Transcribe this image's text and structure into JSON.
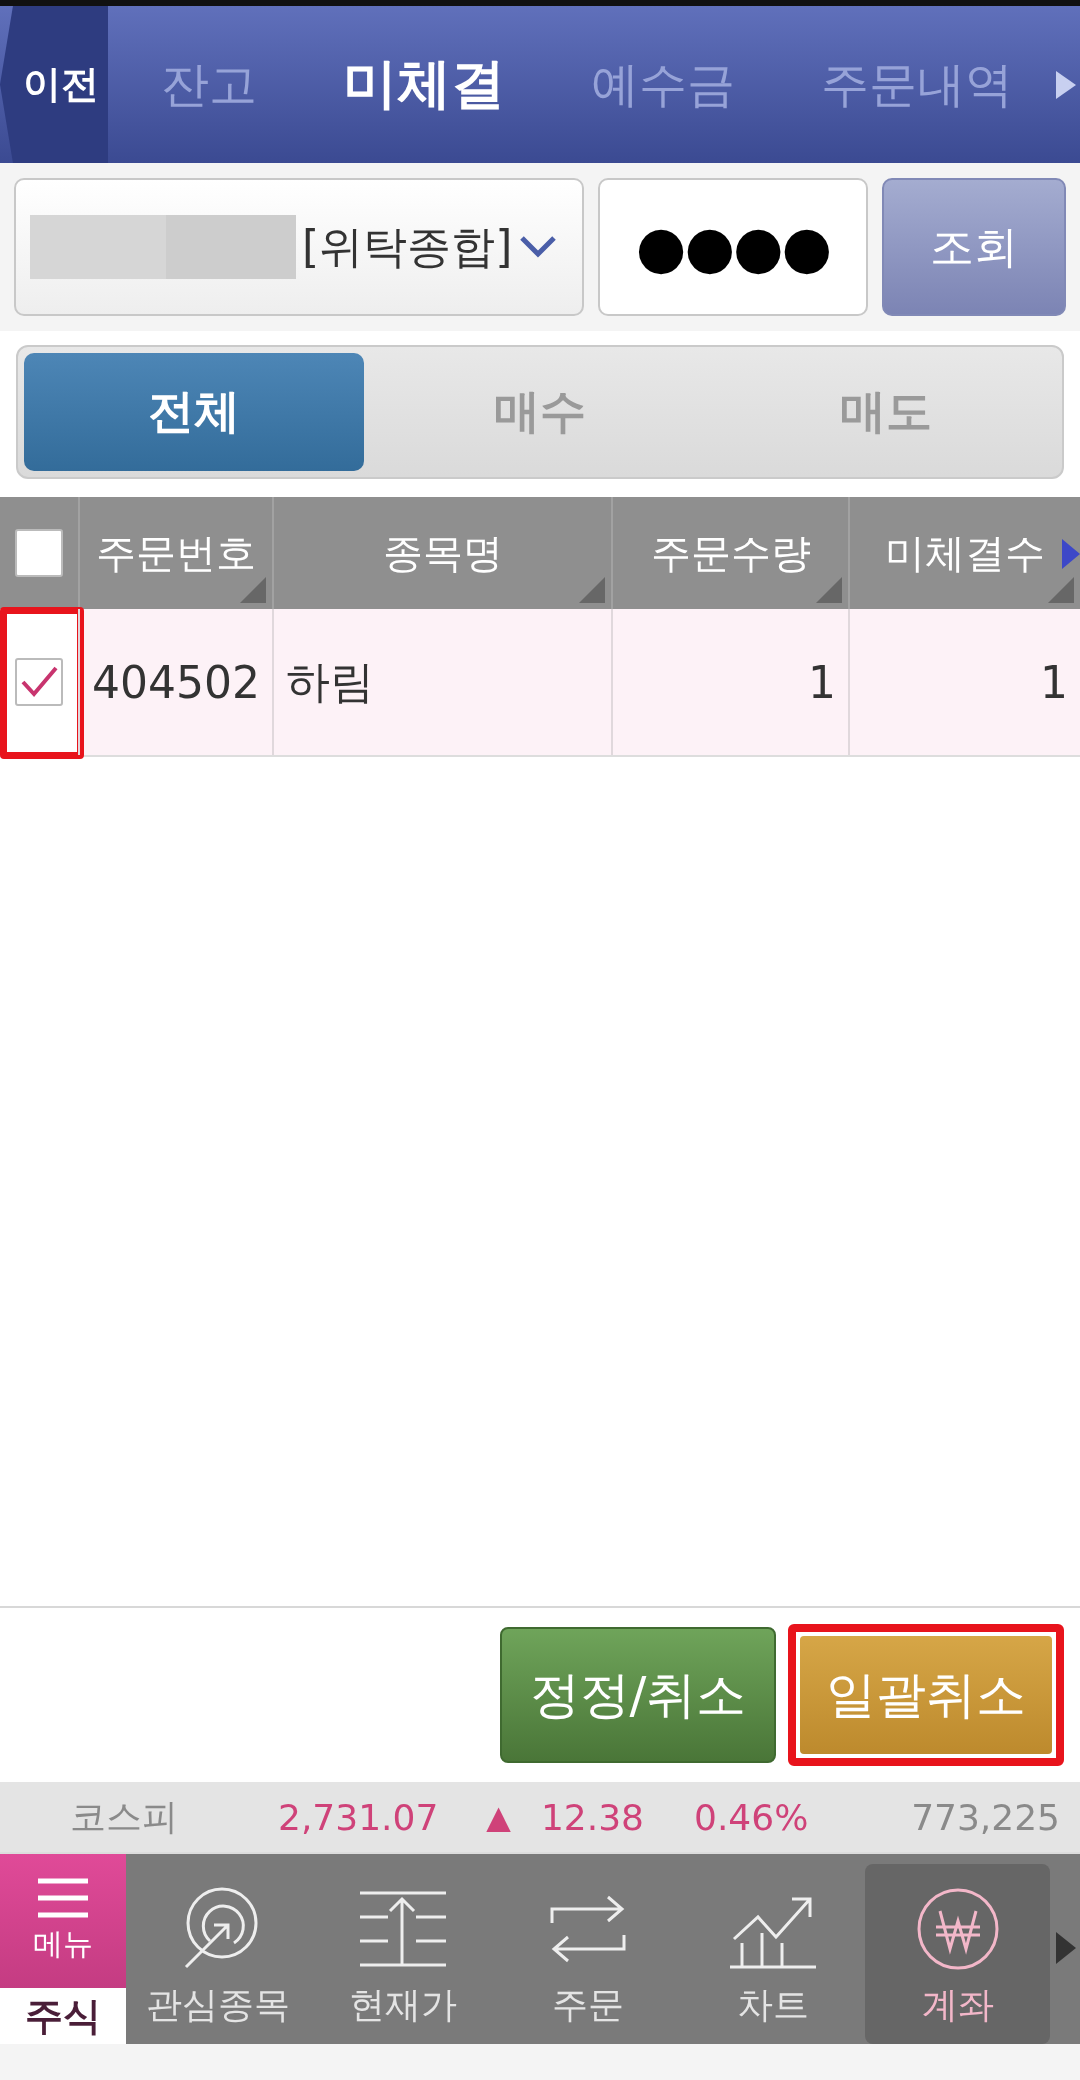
{
  "header": {
    "back_button": "이전",
    "tabs": [
      {
        "label": "잔고",
        "selected": false
      },
      {
        "label": "미체결",
        "selected": true
      },
      {
        "label": "예수금",
        "selected": false
      },
      {
        "label": "주문내역",
        "selected": false
      }
    ]
  },
  "account": {
    "account_type": "[위탁종합]",
    "password": "●●●●",
    "query_button": "조회"
  },
  "filter_tabs": [
    {
      "label": "전체",
      "selected": true
    },
    {
      "label": "매수",
      "selected": false
    },
    {
      "label": "매도",
      "selected": false
    }
  ],
  "table": {
    "select_all_checked": false,
    "columns": [
      "주문번호",
      "종목명",
      "주문수량",
      "미체결수"
    ],
    "rows": [
      {
        "checked": true,
        "highlighted": true,
        "cells": [
          "404502",
          "하림",
          "1",
          "1"
        ]
      }
    ]
  },
  "actions": [
    {
      "label": "정정/취소",
      "kind": "green",
      "highlighted": false
    },
    {
      "label": "일괄취소",
      "kind": "gold",
      "highlighted": true
    }
  ],
  "ticker": {
    "index": "코스피",
    "value": "2,731.07",
    "arrow": "▲",
    "change": "12.38",
    "percent": "0.46%",
    "volume": "773,225"
  },
  "nav": {
    "menu_label": "메뉴",
    "section_label": "주식",
    "items": [
      {
        "label": "관심종목",
        "selected": false
      },
      {
        "label": "현재가",
        "selected": false
      },
      {
        "label": "주문",
        "selected": false
      },
      {
        "label": "차트",
        "selected": false
      },
      {
        "label": "계좌",
        "selected": true
      }
    ]
  }
}
